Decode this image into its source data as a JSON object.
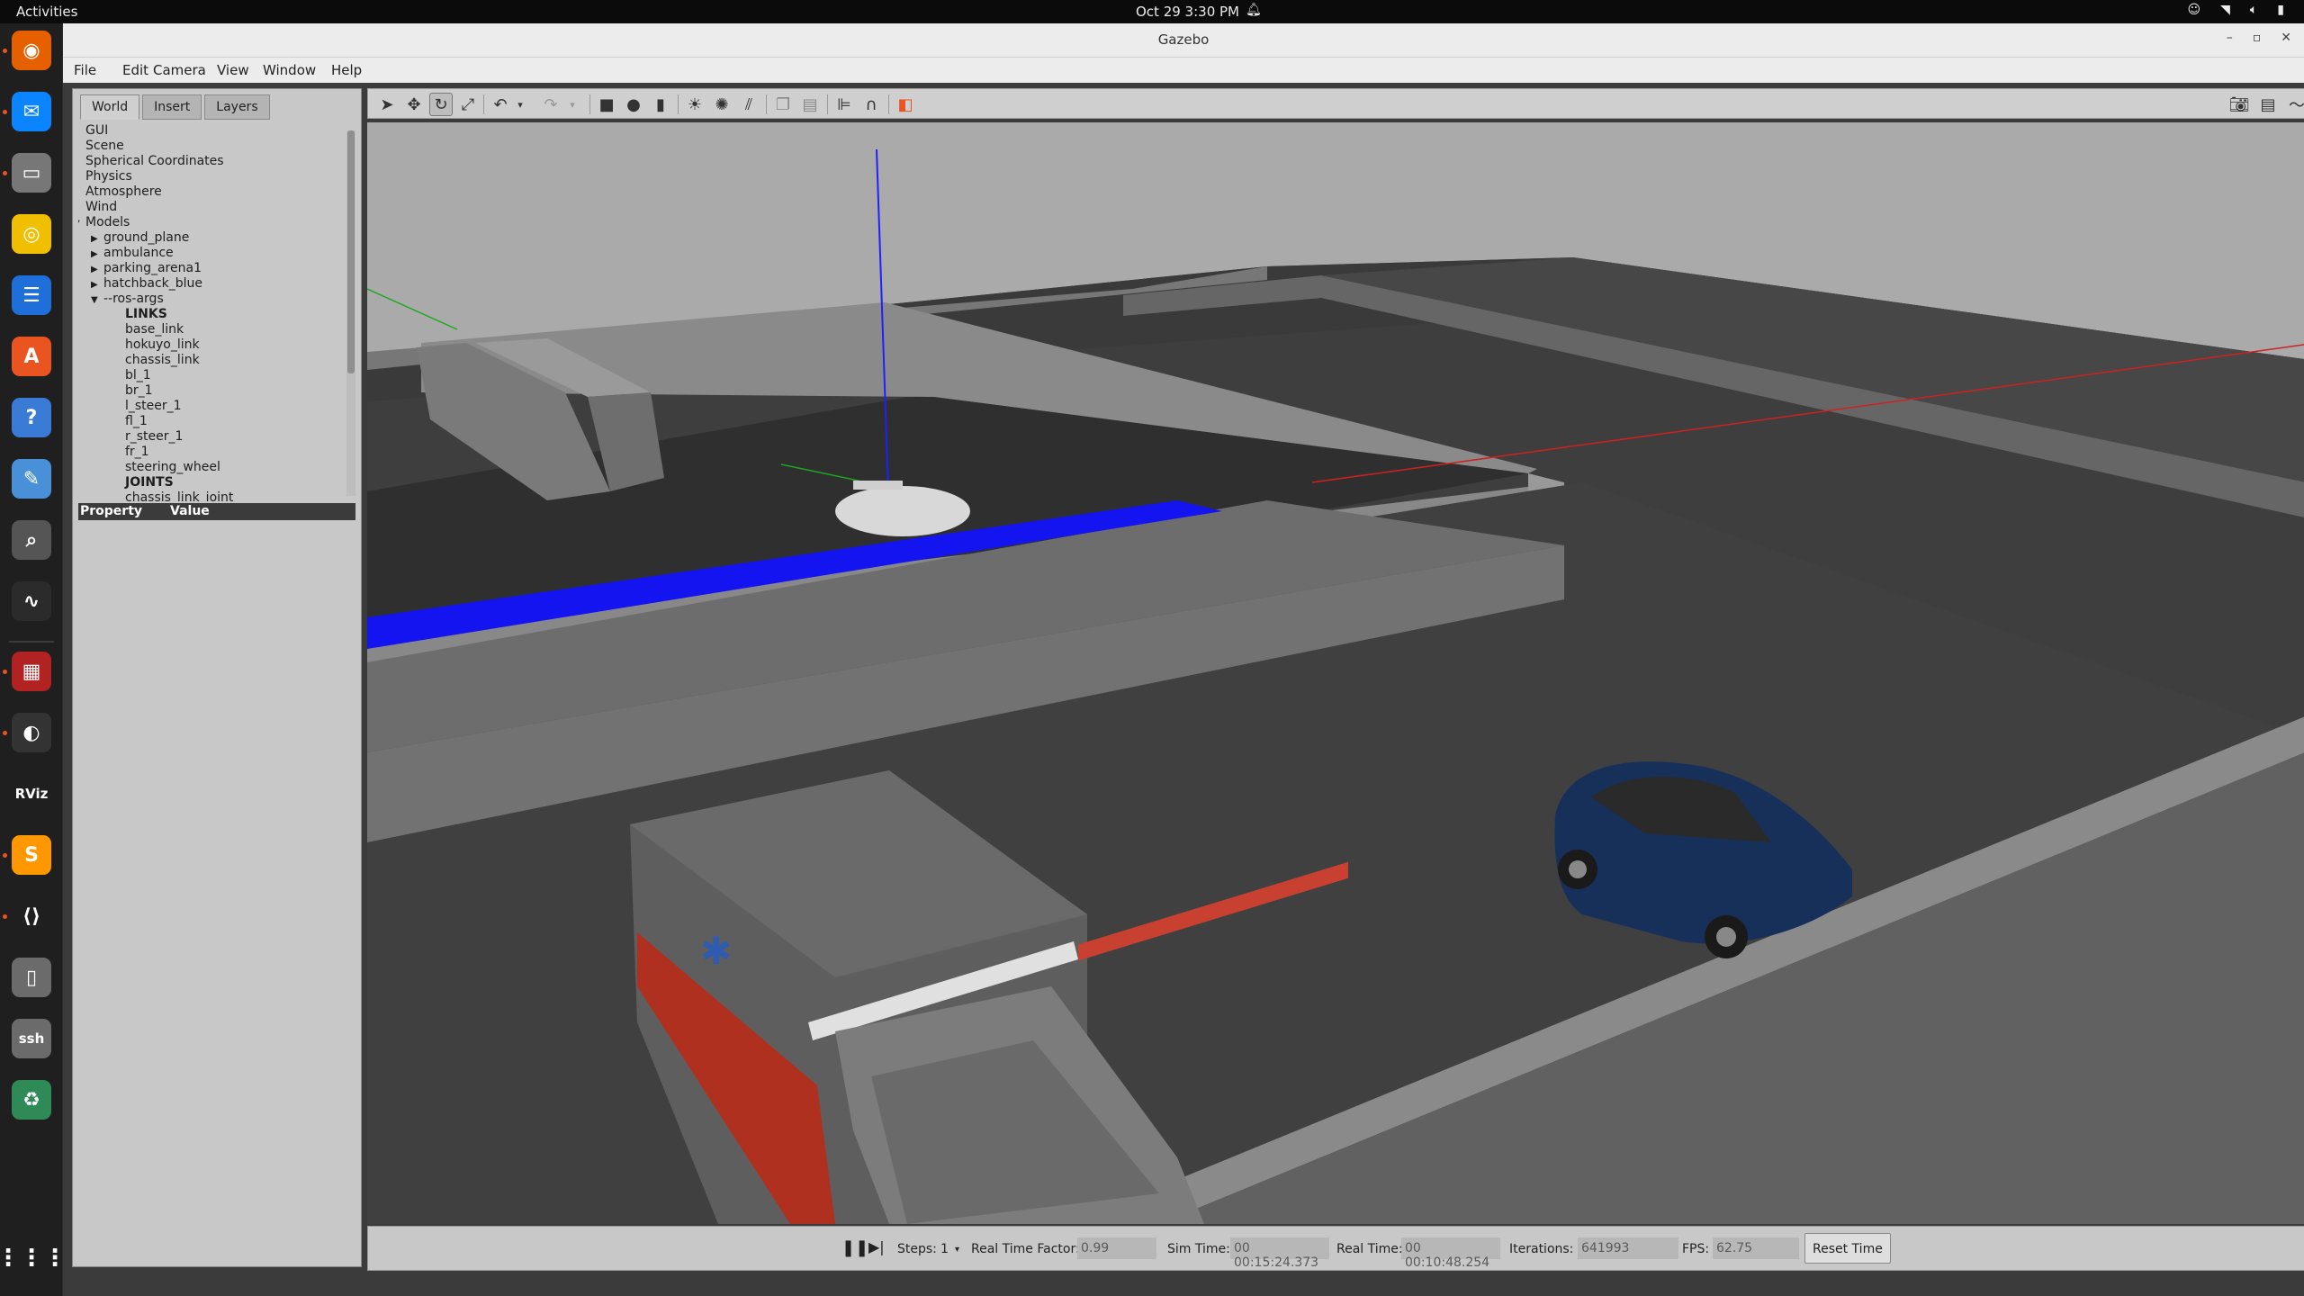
{
  "topbar": {
    "activities": "Activities",
    "clock": "Oct 29   3:30 PM"
  },
  "dock": {
    "apps": [
      {
        "name": "firefox-icon",
        "glyph": "◉",
        "color": "#e66000"
      },
      {
        "name": "thunderbird-icon",
        "glyph": "✉",
        "color": "#0a84ff"
      },
      {
        "name": "files-icon",
        "glyph": "▭",
        "color": "#777777"
      },
      {
        "name": "rhythmbox-icon",
        "glyph": "◎",
        "color": "#f0c000"
      },
      {
        "name": "writer-icon",
        "glyph": "☰",
        "color": "#1e6fd9"
      },
      {
        "name": "app-center-icon",
        "glyph": "A",
        "color": "#e95420"
      },
      {
        "name": "help-icon",
        "glyph": "?",
        "color": "#3a7bd5"
      },
      {
        "name": "text-editor-icon",
        "glyph": "✎",
        "color": "#4a90d9"
      },
      {
        "name": "image-viewer-icon",
        "glyph": "⌕",
        "color": "#555555"
      },
      {
        "name": "system-monitor-icon",
        "glyph": "∿",
        "color": "#2b2b2b"
      },
      {
        "name": "gazebo-panel-icon",
        "glyph": "▦",
        "color": "#b22222"
      },
      {
        "name": "gazebo-icon",
        "glyph": "◐",
        "color": "#333333"
      },
      {
        "name": "rviz-icon",
        "glyph": "RViz",
        "color": "#1f1f1f"
      },
      {
        "name": "sublime-icon",
        "glyph": "S",
        "color": "#ff9800"
      },
      {
        "name": "vscode-icon",
        "glyph": "⟨⟩",
        "color": "#1f1f1f"
      },
      {
        "name": "terminal-icon",
        "glyph": "▯",
        "color": "#6b6b6b"
      },
      {
        "name": "ssh-icon",
        "glyph": "ssh",
        "color": "#6b6b6b"
      },
      {
        "name": "trash-icon",
        "glyph": "♻",
        "color": "#2e8b57"
      }
    ],
    "grid_icon": "show-apps-icon"
  },
  "window": {
    "title": "Gazebo"
  },
  "menu": {
    "file": "File",
    "edit": "Edit",
    "camera": "Camera",
    "view": "View",
    "window": "Window",
    "help": "Help"
  },
  "tabs": {
    "world": "World",
    "insert": "Insert",
    "layers": "Layers"
  },
  "tree": [
    {
      "label": "GUI",
      "indent": 0,
      "arrow": "",
      "bold": false
    },
    {
      "label": "Scene",
      "indent": 0,
      "arrow": "",
      "bold": false
    },
    {
      "label": "Spherical Coordinates",
      "indent": 0,
      "arrow": "",
      "bold": false
    },
    {
      "label": "Physics",
      "indent": 0,
      "arrow": "",
      "bold": false
    },
    {
      "label": "Atmosphere",
      "indent": 0,
      "arrow": "",
      "bold": false
    },
    {
      "label": "Wind",
      "indent": 0,
      "arrow": "",
      "bold": false
    },
    {
      "label": "Models",
      "indent": 0,
      "arrow": "▼",
      "bold": false
    },
    {
      "label": "ground_plane",
      "indent": 1,
      "arrow": "▶",
      "bold": false
    },
    {
      "label": "ambulance",
      "indent": 1,
      "arrow": "▶",
      "bold": false
    },
    {
      "label": "parking_arena1",
      "indent": 1,
      "arrow": "▶",
      "bold": false
    },
    {
      "label": "hatchback_blue",
      "indent": 1,
      "arrow": "▶",
      "bold": false
    },
    {
      "label": "--ros-args",
      "indent": 1,
      "arrow": "▼",
      "bold": false
    },
    {
      "label": "LINKS",
      "indent": 2,
      "arrow": "",
      "bold": true
    },
    {
      "label": "base_link",
      "indent": 2,
      "arrow": "",
      "bold": false
    },
    {
      "label": "hokuyo_link",
      "indent": 2,
      "arrow": "",
      "bold": false
    },
    {
      "label": "chassis_link",
      "indent": 2,
      "arrow": "",
      "bold": false
    },
    {
      "label": "bl_1",
      "indent": 2,
      "arrow": "",
      "bold": false
    },
    {
      "label": "br_1",
      "indent": 2,
      "arrow": "",
      "bold": false
    },
    {
      "label": "l_steer_1",
      "indent": 2,
      "arrow": "",
      "bold": false
    },
    {
      "label": "fl_1",
      "indent": 2,
      "arrow": "",
      "bold": false
    },
    {
      "label": "r_steer_1",
      "indent": 2,
      "arrow": "",
      "bold": false
    },
    {
      "label": "fr_1",
      "indent": 2,
      "arrow": "",
      "bold": false
    },
    {
      "label": "steering_wheel",
      "indent": 2,
      "arrow": "",
      "bold": false
    },
    {
      "label": "JOINTS",
      "indent": 2,
      "arrow": "",
      "bold": true
    },
    {
      "label": "chassis_link_joint",
      "indent": 2,
      "arrow": "",
      "bold": false
    }
  ],
  "properties": {
    "col_property": "Property",
    "col_value": "Value"
  },
  "toolbar": {
    "left_icons": [
      "select-arrow-icon",
      "translate-icon",
      "rotate-icon",
      "scale-icon",
      "undo-icon",
      "undo-dropdown-icon",
      "redo-icon",
      "redo-dropdown-icon",
      "box-icon",
      "sphere-icon",
      "cylinder-icon",
      "point-light-icon",
      "spot-light-icon",
      "directional-light-icon",
      "copy-icon",
      "paste-icon",
      "align-icon",
      "snap-icon",
      "view-angle-icon"
    ],
    "right_icons": [
      "screenshot-icon",
      "log-icon",
      "plot-icon",
      "video-record-icon"
    ]
  },
  "status": {
    "steps_label": "Steps:",
    "steps_value": "1",
    "rtf_label": "Real Time Factor:",
    "rtf_value": "0.99",
    "sim_time_label": "Sim Time:",
    "sim_time_value": "00 00:15:24.373",
    "real_time_label": "Real Time:",
    "real_time_value": "00 00:10:48.254",
    "iterations_label": "Iterations:",
    "iterations_value": "641993",
    "fps_label": "FPS:",
    "fps_value": "62.75",
    "reset_label": "Reset Time"
  },
  "colors": {
    "accent_blue_strip": "#1010f0",
    "car_blue": "#17305a",
    "ubuntu_orange": "#e95420"
  }
}
